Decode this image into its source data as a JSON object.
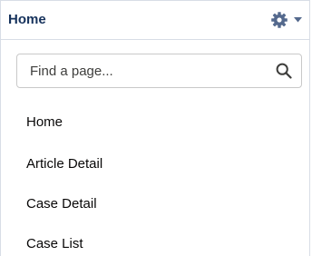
{
  "header": {
    "title": "Home",
    "settings_icon": "gear-icon",
    "dropdown_icon": "caret-down-icon",
    "title_color": "#16325c"
  },
  "search": {
    "placeholder": "Find a page...",
    "value": "",
    "icon": "search-icon"
  },
  "nav": {
    "items": [
      {
        "label": "Home"
      },
      {
        "label": "Article Detail"
      },
      {
        "label": "Case Detail"
      },
      {
        "label": "Case List"
      }
    ]
  }
}
